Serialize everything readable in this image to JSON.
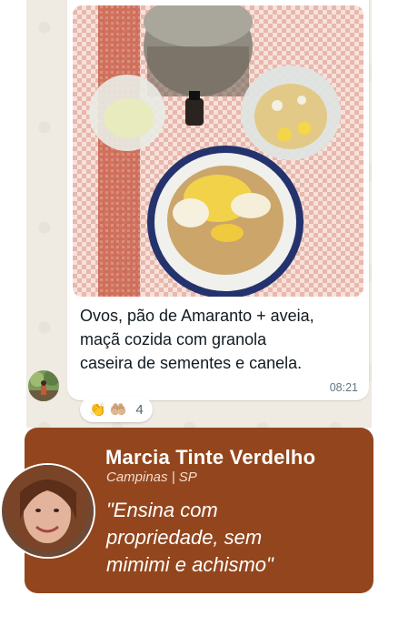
{
  "message": {
    "caption": "Ovos, pão de Amaranto + aveia,\nmaçã cozida com granola\ncaseira de sementes e canela.",
    "time": "08:21",
    "photo_icon": "meal-photo",
    "sender_avatar_icon": "user-avatar"
  },
  "reactions": {
    "emojis": [
      "👏",
      "🤲🏼"
    ],
    "count": "4"
  },
  "testimonial": {
    "name": "Marcia Tinte Verdelho",
    "location": "Campinas | SP",
    "quote": "\"Ensina com\npropriedade, sem\nmimimi e achismo\"",
    "accent_color": "#93461d"
  }
}
